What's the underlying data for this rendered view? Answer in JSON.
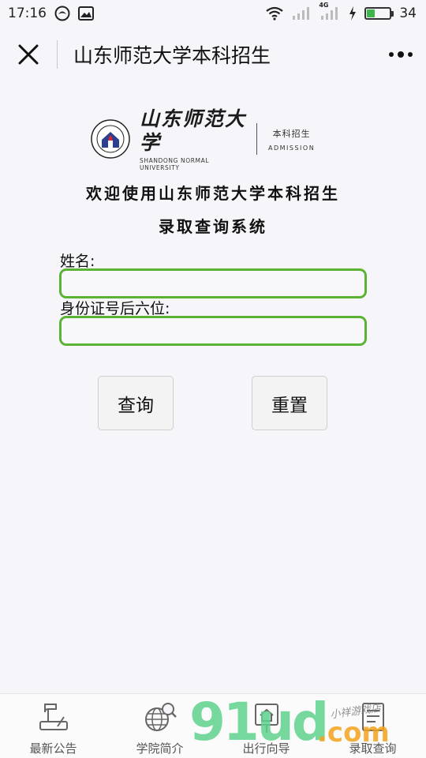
{
  "status_bar": {
    "time": "17:16",
    "battery_level": "34",
    "network_label": "4G"
  },
  "nav": {
    "title": "山东师范大学本科招生"
  },
  "logo": {
    "name_cn": "山东师范大学",
    "name_en": "SHANDONG NORMAL UNIVERSITY",
    "admission_cn": "本科招生",
    "admission_en": "ADMISSION"
  },
  "heading": {
    "line1": "欢迎使用山东师范大学本科招生",
    "line2": "录取查询系统"
  },
  "form": {
    "name_label": "姓名:",
    "name_value": "",
    "id_label": "身份证号后六位:",
    "id_value": "",
    "submit_label": "查询",
    "reset_label": "重置"
  },
  "tabs": [
    {
      "label": "最新公告",
      "icon": "gramophone-icon"
    },
    {
      "label": "学院简介",
      "icon": "globe-search-icon"
    },
    {
      "label": "出行向导",
      "icon": "home-route-icon"
    },
    {
      "label": "录取查询",
      "icon": "document-icon"
    }
  ],
  "watermark": {
    "num": "91ud",
    "com": ".com",
    "hand": "小祥游戏店"
  },
  "colors": {
    "field_border": "#5bb335",
    "background": "#f6f6fa"
  }
}
